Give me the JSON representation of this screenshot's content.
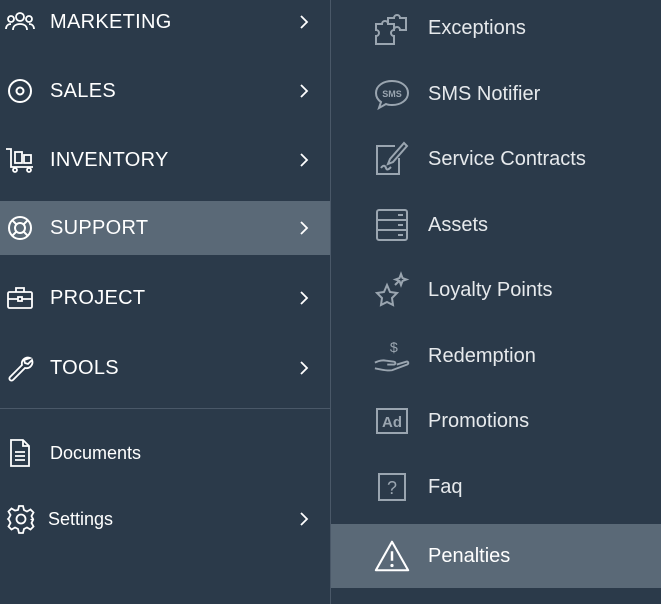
{
  "colors": {
    "background": "#2b3a4a",
    "active_background": "#5a6977",
    "divider": "#4a5868",
    "icon_muted": "#9aa5b0",
    "text": "#ffffff"
  },
  "main_menu": {
    "items": [
      {
        "label": "MARKETING",
        "icon": "users-group-icon",
        "has_chevron": true
      },
      {
        "label": "SALES",
        "icon": "target-circle-icon",
        "has_chevron": true
      },
      {
        "label": "INVENTORY",
        "icon": "cart-trolley-icon",
        "has_chevron": true
      },
      {
        "label": "SUPPORT",
        "icon": "lifebuoy-icon",
        "has_chevron": true,
        "active": true
      },
      {
        "label": "PROJECT",
        "icon": "briefcase-icon",
        "has_chevron": true
      },
      {
        "label": "TOOLS",
        "icon": "wrench-icon",
        "has_chevron": true
      }
    ],
    "secondary_items": [
      {
        "label": "Documents",
        "icon": "document-icon",
        "has_chevron": false
      },
      {
        "label": "Settings",
        "icon": "gear-icon",
        "has_chevron": true
      }
    ]
  },
  "submenu": {
    "items": [
      {
        "label": "Exceptions",
        "icon": "puzzle-icon"
      },
      {
        "label": "SMS Notifier",
        "icon": "sms-bubble-icon"
      },
      {
        "label": "Service Contracts",
        "icon": "contract-edit-icon"
      },
      {
        "label": "Assets",
        "icon": "server-stack-icon"
      },
      {
        "label": "Loyalty Points",
        "icon": "star-sparkle-icon"
      },
      {
        "label": "Redemption",
        "icon": "hand-dollar-icon"
      },
      {
        "label": "Promotions",
        "icon": "ad-icon"
      },
      {
        "label": "Faq",
        "icon": "question-box-icon"
      },
      {
        "label": "Penalties",
        "icon": "warning-triangle-icon",
        "active": true
      }
    ]
  }
}
